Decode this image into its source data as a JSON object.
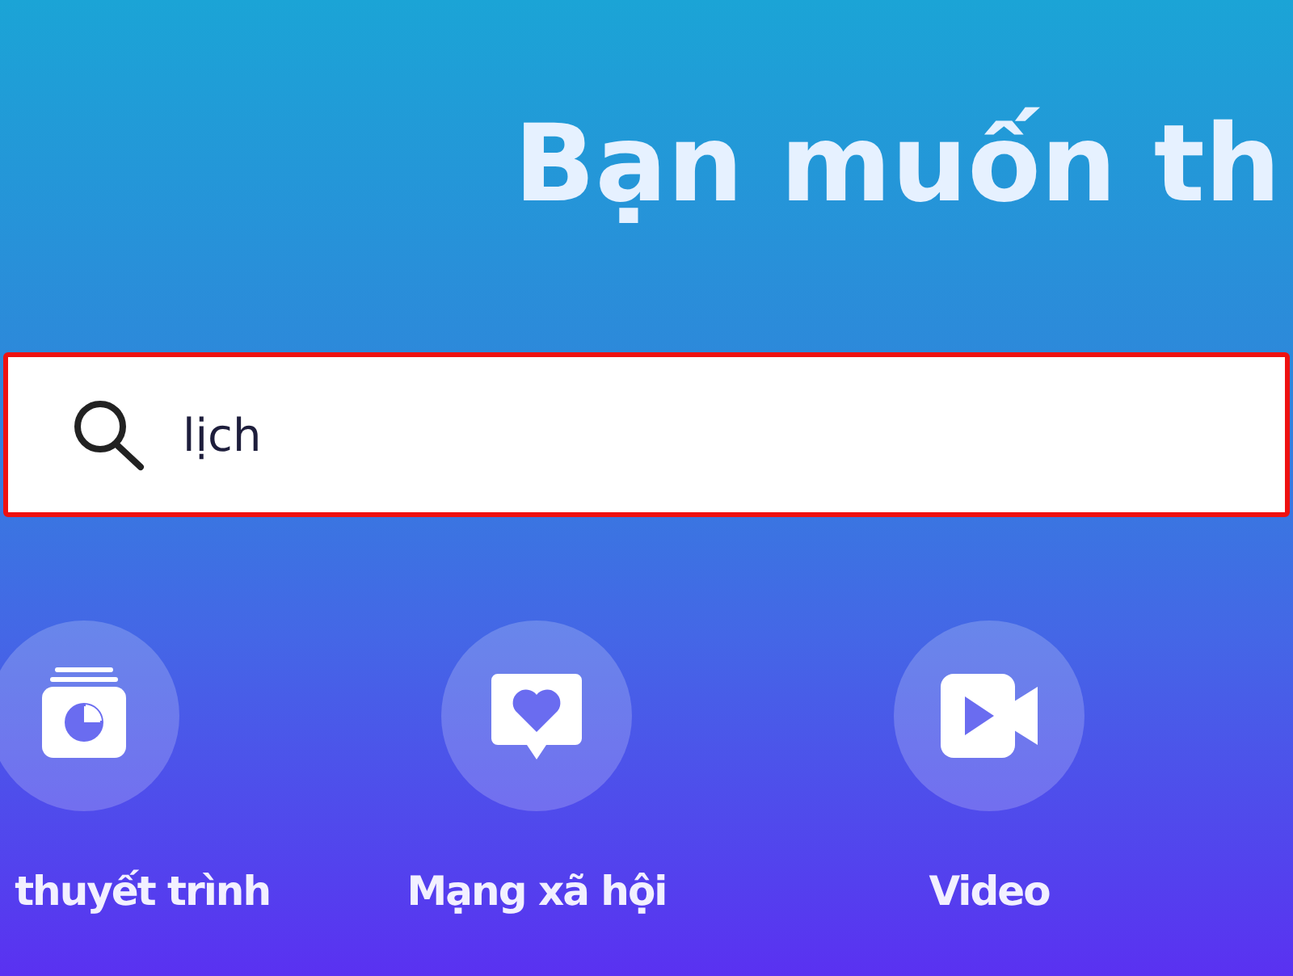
{
  "heading": "Bạn muốn th",
  "search": {
    "value": "lịch",
    "highlighted": true
  },
  "categories": [
    {
      "label": "thuyết trình",
      "kind": "presentation"
    },
    {
      "label": "Mạng xã hội",
      "kind": "social"
    },
    {
      "label": "Video",
      "kind": "video"
    }
  ]
}
